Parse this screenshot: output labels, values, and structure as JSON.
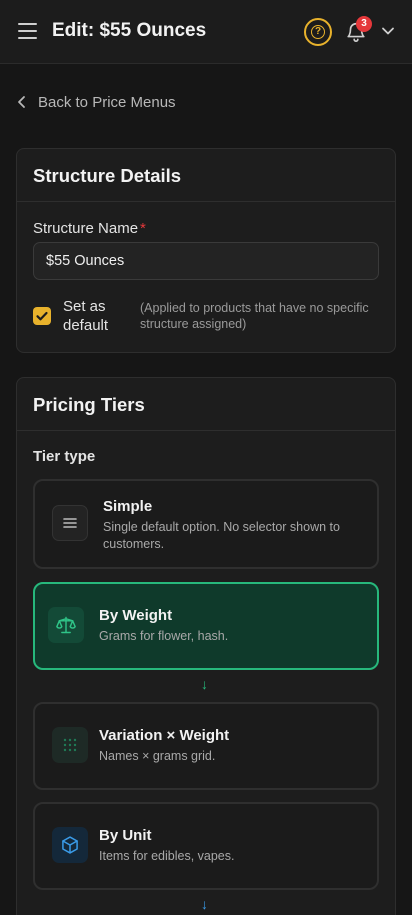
{
  "header": {
    "title": "Edit: $55 Ounces",
    "notification_count": "3",
    "help_glyph": "?"
  },
  "back_link": "Back to Price Menus",
  "structure": {
    "title": "Structure Details",
    "name_label": "Structure Name",
    "required_mark": "*",
    "name_value": "$55 Ounces",
    "default_label": "Set as default",
    "default_checked": true,
    "default_note": "(Applied to products that have no specific structure assigned)"
  },
  "pricing": {
    "title": "Pricing Tiers",
    "tier_type_label": "Tier type",
    "tiers": [
      {
        "title": "Simple",
        "desc": "Single default option. No selector shown to customers.",
        "icon": "menu-lines-icon",
        "selected": false
      },
      {
        "title": "By Weight",
        "desc": "Grams for flower, hash.",
        "icon": "scale-icon",
        "selected": true
      },
      {
        "title": "Variation × Weight",
        "desc": "Names × grams grid.",
        "icon": "grid-dots-icon",
        "selected": false
      },
      {
        "title": "By Unit",
        "desc": "Items for edibles, vapes.",
        "icon": "box-icon",
        "selected": false
      }
    ],
    "arrow_glyph": "↓"
  },
  "colors": {
    "accent_yellow": "#e8b22c",
    "accent_green": "#27b87c",
    "accent_blue": "#3a9be8",
    "badge_red": "#e5383b"
  }
}
